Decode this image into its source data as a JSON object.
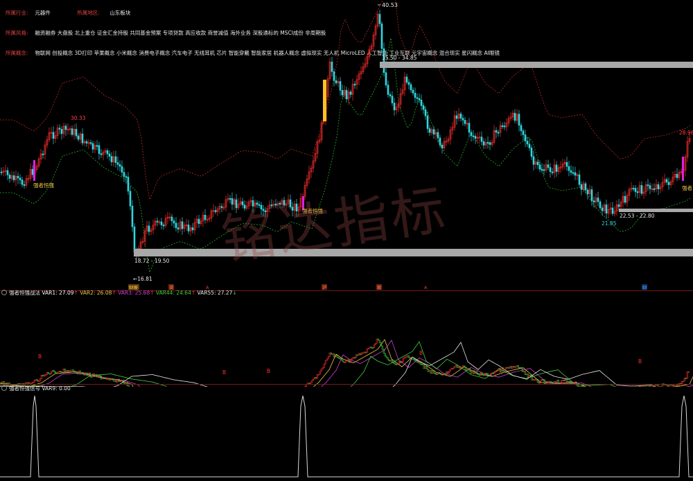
{
  "info": {
    "industry_label": "所属行业:",
    "industry_value": "元器件",
    "region_label": "所属地区:",
    "region_value": "山东板块",
    "style_label": "所属风格:",
    "style_value": "融资融券 大盘股 北上重仓 证金汇金持股 共同基金预案 专项贷款 高应收款 商誉减值 海外业务 深股通标的 MSCI成份 非周期股",
    "concept_label": "所属概念:",
    "concept_value": "物联网 创投概念 3D打印 苹果概念 小米概念 消费电子概念 汽车电子 无线耳机 芯片 智能穿戴 智能家居 机器人概念 虚拟现实 无人机 MicroLED 人工智能 工业互联 元宇宙概念 混合现实 星闪概念 AI眼镜"
  },
  "main_chart": {
    "high_label": "40.53",
    "low_label": "←16.81",
    "peak_left_label": "30.33",
    "recent_high_label": "28.96",
    "recent_low_label": "21.85",
    "zone_top_label": "35.50 - 34.85",
    "zone_mid_label": "22.53 - 22.80",
    "zone_bottom_label": "18.72 - 19.50",
    "signal_labels": [
      "强者恒强",
      "强者恒强",
      "强者"
    ],
    "event_markers": [
      "财报",
      "资",
      "A",
      "沪",
      "股",
      "A",
      "财"
    ],
    "colors": {
      "up": "#ff3030",
      "down": "#30d8e0",
      "upper_band": "#c02828",
      "lower_band": "#28b028",
      "zone": "#a8a8a8",
      "flag_yellow": "#ffc020",
      "flag_magenta": "#e020e0"
    }
  },
  "panel2": {
    "title": "强者恒强战法",
    "var1": "VAR1: 27.09",
    "var2": "VAR2: 26.08",
    "var3": "VAR3: 25.68",
    "var4": "VAR44: 24.64",
    "var5": "VAR55: 27.27",
    "markers": [
      "B",
      "B",
      "B",
      "B",
      "B"
    ]
  },
  "panel3": {
    "title": "强者恒强信号",
    "var9": "VAR9: 0.00"
  },
  "watermark": "铭达指标"
}
